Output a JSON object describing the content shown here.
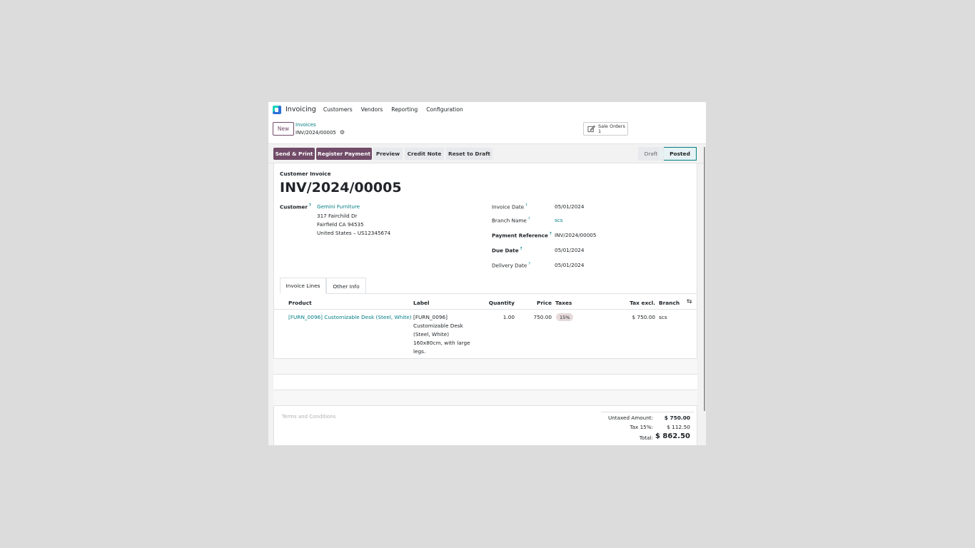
{
  "nav": {
    "app_name": "Invoicing",
    "menu": [
      "Customers",
      "Vendors",
      "Reporting",
      "Configuration"
    ]
  },
  "control": {
    "new_label": "New",
    "breadcrumb_parent": "Invoices",
    "breadcrumb_current": "INV/2024/00005",
    "smart_button": {
      "label": "Sale Orders",
      "count": "1",
      "icon": "edit-icon"
    }
  },
  "statusbar": {
    "buttons": [
      "Send & Print",
      "Register Payment",
      "Preview",
      "Credit Note",
      "Reset to Draft"
    ],
    "stages": [
      "Draft",
      "Posted"
    ],
    "current_stage": "Posted"
  },
  "form": {
    "type_label": "Customer Invoice",
    "name": "INV/2024/00005",
    "customer": {
      "label": "Customer",
      "name": "Gemini Furniture",
      "address": [
        "317 Fairchild Dr",
        "Fairfield CA 94535",
        "United States – US12345674"
      ]
    },
    "right_fields": [
      {
        "label": "Invoice Date",
        "value": "05/01/2024"
      },
      {
        "label": "Branch Name",
        "value": "scs"
      },
      {
        "label": "Payment Reference",
        "value": "INV/2024/00005"
      },
      {
        "label": "Due Date",
        "value": "05/01/2024"
      },
      {
        "label": "Delivery Date",
        "value": "05/01/2024"
      }
    ]
  },
  "tabs": [
    "Invoice Lines",
    "Other Info"
  ],
  "table": {
    "headers": [
      "Product",
      "Label",
      "Quantity",
      "Price",
      "Taxes",
      "Tax excl.",
      "Branch"
    ],
    "rows": [
      {
        "product": "[FURN_0096] Customizable Desk (Steel, White)",
        "label": "[FURN_0096] Customizable Desk (Steel, White) 160x80cm, with large legs.",
        "quantity": "1.00",
        "price": "750.00",
        "taxes": "15%",
        "tax_excl": "$ 750.00",
        "branch": "scs"
      }
    ]
  },
  "terms_placeholder": "Terms and Conditions",
  "totals": {
    "untaxed_label": "Untaxed Amount:",
    "untaxed_value": "$ 750.00",
    "tax_label": "Tax 15%:",
    "tax_value": "$ 112.50",
    "total_label": "Total:",
    "total_value": "$ 862.50"
  },
  "colors": {
    "primary": "#714b67",
    "link": "#017e84"
  }
}
